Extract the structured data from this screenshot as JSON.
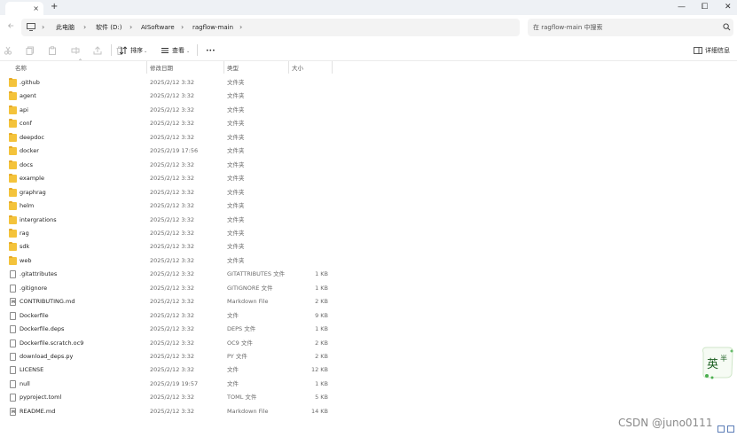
{
  "window": {
    "new_tab": "+",
    "tab_close": "×",
    "controls": {
      "minimize": "—",
      "maximize": "⧠",
      "close": "✕"
    }
  },
  "address": {
    "crumbs": [
      "此电脑",
      "软件 (D:)",
      "AISoftware",
      "ragflow-main"
    ],
    "search_placeholder": "在 ragflow-main 中搜索"
  },
  "toolbar": {
    "sort_label": "排序",
    "view_label": "查看",
    "more_label": "•••",
    "details_label": "详细信息"
  },
  "columns": {
    "name": "名称",
    "date": "修改日期",
    "type": "类型",
    "size": "大小"
  },
  "files": [
    {
      "name": ".github",
      "date": "2025/2/12 3:32",
      "type": "文件夹",
      "size": "",
      "kind": "folder"
    },
    {
      "name": "agent",
      "date": "2025/2/12 3:32",
      "type": "文件夹",
      "size": "",
      "kind": "folder"
    },
    {
      "name": "api",
      "date": "2025/2/12 3:32",
      "type": "文件夹",
      "size": "",
      "kind": "folder"
    },
    {
      "name": "conf",
      "date": "2025/2/12 3:32",
      "type": "文件夹",
      "size": "",
      "kind": "folder"
    },
    {
      "name": "deepdoc",
      "date": "2025/2/12 3:32",
      "type": "文件夹",
      "size": "",
      "kind": "folder"
    },
    {
      "name": "docker",
      "date": "2025/2/19 17:56",
      "type": "文件夹",
      "size": "",
      "kind": "folder"
    },
    {
      "name": "docs",
      "date": "2025/2/12 3:32",
      "type": "文件夹",
      "size": "",
      "kind": "folder"
    },
    {
      "name": "example",
      "date": "2025/2/12 3:32",
      "type": "文件夹",
      "size": "",
      "kind": "folder"
    },
    {
      "name": "graphrag",
      "date": "2025/2/12 3:32",
      "type": "文件夹",
      "size": "",
      "kind": "folder"
    },
    {
      "name": "helm",
      "date": "2025/2/12 3:32",
      "type": "文件夹",
      "size": "",
      "kind": "folder"
    },
    {
      "name": "intergrations",
      "date": "2025/2/12 3:32",
      "type": "文件夹",
      "size": "",
      "kind": "folder"
    },
    {
      "name": "rag",
      "date": "2025/2/12 3:32",
      "type": "文件夹",
      "size": "",
      "kind": "folder"
    },
    {
      "name": "sdk",
      "date": "2025/2/12 3:32",
      "type": "文件夹",
      "size": "",
      "kind": "folder"
    },
    {
      "name": "web",
      "date": "2025/2/12 3:32",
      "type": "文件夹",
      "size": "",
      "kind": "folder"
    },
    {
      "name": ".gitattributes",
      "date": "2025/2/12 3:32",
      "type": "GITATTRIBUTES 文件",
      "size": "1 KB",
      "kind": "file"
    },
    {
      "name": ".gitignore",
      "date": "2025/2/12 3:32",
      "type": "GITIGNORE 文件",
      "size": "1 KB",
      "kind": "file"
    },
    {
      "name": "CONTRIBUTING.md",
      "date": "2025/2/12 3:32",
      "type": "Markdown File",
      "size": "2 KB",
      "kind": "md"
    },
    {
      "name": "Dockerfile",
      "date": "2025/2/12 3:32",
      "type": "文件",
      "size": "9 KB",
      "kind": "file"
    },
    {
      "name": "Dockerfile.deps",
      "date": "2025/2/12 3:32",
      "type": "DEPS 文件",
      "size": "1 KB",
      "kind": "file"
    },
    {
      "name": "Dockerfile.scratch.oc9",
      "date": "2025/2/12 3:32",
      "type": "OC9 文件",
      "size": "2 KB",
      "kind": "file"
    },
    {
      "name": "download_deps.py",
      "date": "2025/2/12 3:32",
      "type": "PY 文件",
      "size": "2 KB",
      "kind": "file"
    },
    {
      "name": "LICENSE",
      "date": "2025/2/12 3:32",
      "type": "文件",
      "size": "12 KB",
      "kind": "file"
    },
    {
      "name": "null",
      "date": "2025/2/19 19:57",
      "type": "文件",
      "size": "1 KB",
      "kind": "file"
    },
    {
      "name": "pyproject.toml",
      "date": "2025/2/12 3:32",
      "type": "TOML 文件",
      "size": "5 KB",
      "kind": "file"
    },
    {
      "name": "README.md",
      "date": "2025/2/12 3:32",
      "type": "Markdown File",
      "size": "14 KB",
      "kind": "md"
    }
  ],
  "ime": {
    "label": "英",
    "badge": "半"
  },
  "watermark": "CSDN @juno0111"
}
